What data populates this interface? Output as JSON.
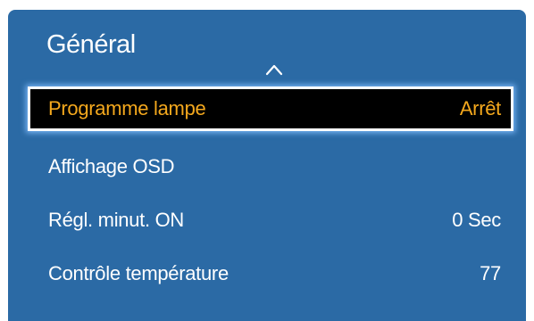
{
  "menu": {
    "title": "Général",
    "scroll_up_icon": "chevron-up-icon",
    "items": [
      {
        "label": "Programme lampe",
        "value": "Arrêt",
        "selected": true
      },
      {
        "label": "Affichage OSD",
        "value": ""
      },
      {
        "label": "Régl. minut. ON",
        "value": "0 Sec"
      },
      {
        "label": "Contrôle température",
        "value": "77"
      }
    ]
  },
  "colors": {
    "panel_background": "#2b6aa5",
    "selected_background": "#000000",
    "selected_text": "#f4a81d",
    "text": "#ffffff",
    "selection_glow": "#82beff"
  }
}
